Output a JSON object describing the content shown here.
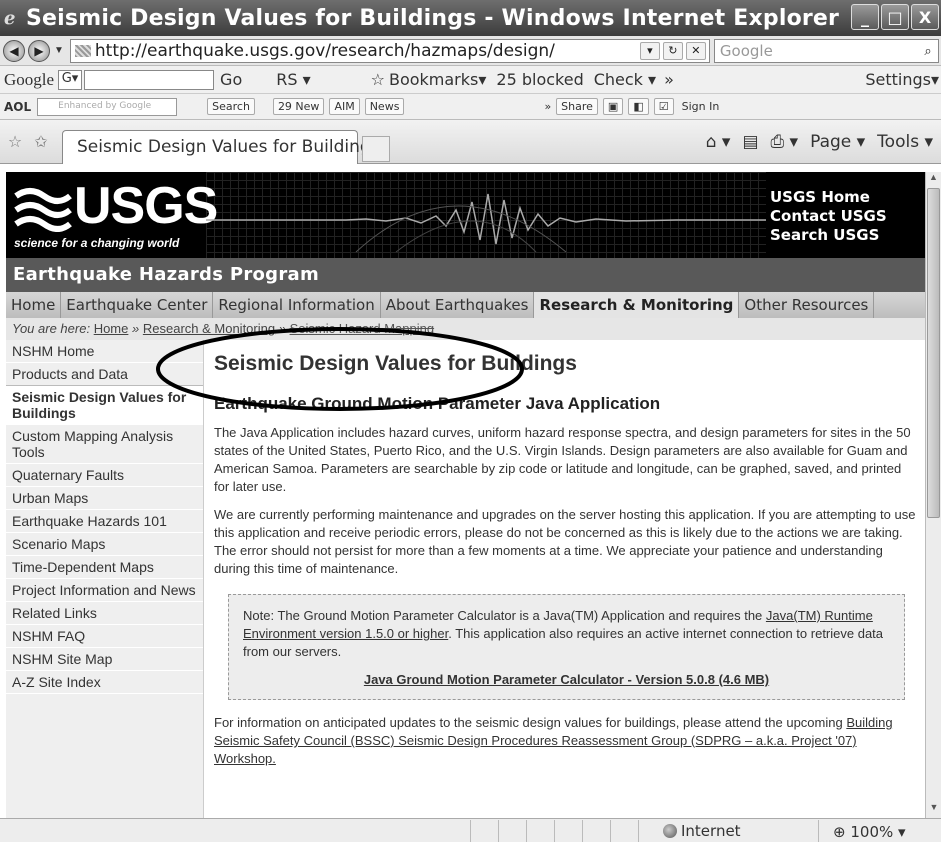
{
  "window": {
    "title": "Seismic Design Values for Buildings - Windows Internet Explorer",
    "min": "_",
    "max": "□",
    "close": "X"
  },
  "address": {
    "url": "http://earthquake.usgs.gov/research/hazmaps/design/",
    "search_placeholder": "Google"
  },
  "google_toolbar": {
    "logo": "Google",
    "field": "G▾",
    "go": "Go",
    "rs": "RS ▾",
    "bookmarks": "Bookmarks▾",
    "blocked": "25 blocked",
    "check": "Check ▾",
    "more": "»",
    "settings": "Settings▾"
  },
  "aol_toolbar": {
    "logo": "AOL",
    "enhanced": "Enhanced by Google",
    "search": "Search",
    "new": "29 New",
    "aim": "AIM",
    "news": "News",
    "more": "»",
    "share": "Share",
    "signin": "Sign In"
  },
  "tabs": {
    "active": "Seismic Design Values for Buildings",
    "page": "Page ▾",
    "tools": "Tools ▾"
  },
  "banner": {
    "logo": "USGS",
    "tagline": "science for a changing world",
    "links": [
      "USGS Home",
      "Contact USGS",
      "Search USGS"
    ]
  },
  "program": "Earthquake Hazards Program",
  "menu": [
    "Home",
    "Earthquake Center",
    "Regional Information",
    "About Earthquakes",
    "Research & Monitoring",
    "Other Resources"
  ],
  "breadcrumb": {
    "prefix": "You are here:",
    "home": "Home",
    "sep1": "»",
    "research": "Research & Monitoring",
    "sep2": "»",
    "current": "Seismic Hazard Mapping"
  },
  "sidebar": [
    "NSHM Home",
    "Products and Data",
    "Seismic Design Values for Buildings",
    "Custom Mapping Analysis Tools",
    "Quaternary Faults",
    "Urban Maps",
    "Earthquake Hazards 101",
    "Scenario Maps",
    "Time-Dependent Maps",
    "Project Information and News",
    "Related Links",
    "NSHM FAQ",
    "NSHM Site Map",
    "A-Z Site Index"
  ],
  "content": {
    "title": "Seismic Design Values for Buildings",
    "subtitle": "Earthquake Ground Motion Parameter Java Application",
    "p1": "The Java Application includes hazard curves, uniform hazard response spectra, and design parameters for sites in the 50 states of the United States, Puerto Rico, and the U.S. Virgin Islands. Design parameters are also available for Guam and American Samoa. Parameters are searchable by zip code or latitude and longitude, can be graphed, saved, and printed for later use.",
    "p2": "We are currently performing maintenance and upgrades on the server hosting this application. If you are attempting to use this application and receive periodic errors, please do not be concerned as this is likely due to the actions we are taking. The error should not persist for more than a few moments at a time. We appreciate your patience and understanding during this time of maintenance.",
    "note_pre": "Note: The Ground Motion Parameter Calculator is a Java(TM) Application and requires the ",
    "note_link": "Java(TM) Runtime Environment version 1.5.0 or higher",
    "note_post": ". This application also requires an active internet connection to retrieve data from our servers.",
    "download": "Java Ground Motion Parameter Calculator - Version 5.0.8 (4.6 MB)",
    "p3_pre": "For information on anticipated updates to the seismic design values for buildings, please attend the upcoming ",
    "p3_link": "Building Seismic Safety Council (BSSC) Seismic Design Procedures Reassessment Group (SDPRG – a.k.a. Project '07) Workshop."
  },
  "status": {
    "zone": "Internet",
    "zoom": "100%"
  }
}
